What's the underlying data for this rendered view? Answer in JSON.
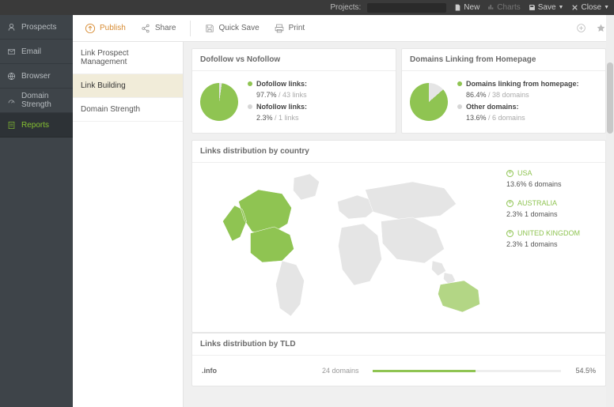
{
  "topbar": {
    "projects_label": "Projects:",
    "new": "New",
    "charts": "Charts",
    "save": "Save",
    "close": "Close"
  },
  "sidebar": {
    "items": [
      {
        "label": "Prospects"
      },
      {
        "label": "Email"
      },
      {
        "label": "Browser"
      },
      {
        "label": "Domain Strength"
      },
      {
        "label": "Reports"
      }
    ]
  },
  "toolbar": {
    "publish": "Publish",
    "share": "Share",
    "quicksave": "Quick Save",
    "print": "Print"
  },
  "subnav": {
    "items": [
      {
        "label": "Link Prospect Management"
      },
      {
        "label": "Link Building"
      },
      {
        "label": "Domain Strength"
      }
    ]
  },
  "cards": {
    "dofollow": {
      "title": "Dofollow vs Nofollow",
      "series": [
        {
          "label": "Dofollow links:",
          "pct": "97.7%",
          "detail": "/ 43 links",
          "color": "#8fc452"
        },
        {
          "label": "Nofollow links:",
          "pct": "2.3%",
          "detail": "/ 1 links",
          "color": "#d6d6d6"
        }
      ]
    },
    "homepage": {
      "title": "Domains Linking from Homepage",
      "series": [
        {
          "label": "Domains linking from homepage:",
          "pct": "86.4%",
          "detail": "/ 38 domains",
          "color": "#8fc452"
        },
        {
          "label": "Other domains:",
          "pct": "13.6%",
          "detail": "/ 6 domains",
          "color": "#d6d6d6"
        }
      ]
    },
    "country": {
      "title": "Links distribution by country",
      "items": [
        {
          "name": "USA",
          "val": "13.6% 6 domains"
        },
        {
          "name": "AUSTRALIA",
          "val": "2.3% 1 domains"
        },
        {
          "name": "UNITED KINGDOM",
          "val": "2.3% 1 domains"
        }
      ]
    },
    "tld": {
      "title": "Links distribution by TLD",
      "rows": [
        {
          "tld": ".info",
          "count": "24 domains",
          "pct": "54.5%",
          "width": 54.5
        }
      ]
    }
  },
  "chart_data": [
    {
      "type": "pie",
      "title": "Dofollow vs Nofollow",
      "series": [
        {
          "name": "Dofollow links",
          "value": 43,
          "pct": 97.7
        },
        {
          "name": "Nofollow links",
          "value": 1,
          "pct": 2.3
        }
      ]
    },
    {
      "type": "pie",
      "title": "Domains Linking from Homepage",
      "series": [
        {
          "name": "Domains linking from homepage",
          "value": 38,
          "pct": 86.4
        },
        {
          "name": "Other domains",
          "value": 6,
          "pct": 13.6
        }
      ]
    },
    {
      "type": "map",
      "title": "Links distribution by country",
      "series": [
        {
          "name": "USA",
          "pct": 13.6,
          "value": 6
        },
        {
          "name": "Australia",
          "pct": 2.3,
          "value": 1
        },
        {
          "name": "United Kingdom",
          "pct": 2.3,
          "value": 1
        }
      ]
    },
    {
      "type": "bar",
      "title": "Links distribution by TLD",
      "categories": [
        ".info"
      ],
      "values": [
        24
      ],
      "pcts": [
        54.5
      ]
    }
  ]
}
